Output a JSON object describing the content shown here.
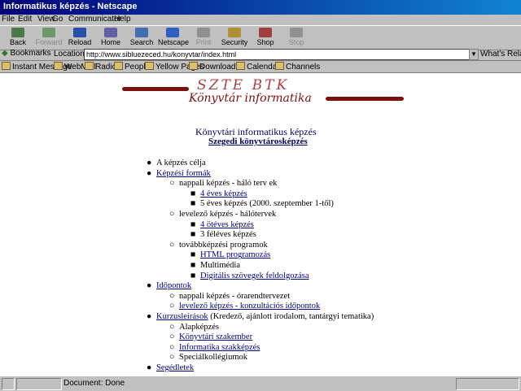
{
  "window": {
    "title": "Informatikus képzés - Netscape"
  },
  "menu": [
    "File",
    "Edit",
    "View",
    "Go",
    "Communicator",
    "Help"
  ],
  "toolbar": [
    {
      "label": "Back",
      "color": "#4a7a4a",
      "disabled": false
    },
    {
      "label": "Forward",
      "color": "#6a9a6a",
      "disabled": true
    },
    {
      "label": "Reload",
      "color": "#2850a8",
      "disabled": false
    },
    {
      "label": "Home",
      "color": "#6060a0",
      "disabled": false
    },
    {
      "label": "Search",
      "color": "#4070b0",
      "disabled": false
    },
    {
      "label": "Netscape",
      "color": "#3060c0",
      "disabled": false
    },
    {
      "label": "Print",
      "color": "#909090",
      "disabled": true
    },
    {
      "label": "Security",
      "color": "#b09030",
      "disabled": false
    },
    {
      "label": "Shop",
      "color": "#a04040",
      "disabled": false
    },
    {
      "label": "Stop",
      "color": "#909090",
      "disabled": true
    }
  ],
  "location": {
    "bookmarks_label": "Bookmarks",
    "label": "Location:",
    "url": "http://www.sibluezeced.hu/konyvtar/index.html",
    "related": "What's Related"
  },
  "personal_bar": [
    "Instant Message",
    "WebMail",
    "Radio",
    "People",
    "Yellow Pages",
    "Download",
    "Calendar",
    "Channels"
  ],
  "banner": {
    "line1": "SZTE BTK",
    "line2": "Könyvtár informatika"
  },
  "heading": "Könyvtári informatikus képzés",
  "subheading": "Szegedi könyvtárosképzés",
  "nav": [
    {
      "level": 0,
      "text": "A képzés célja",
      "link": false
    },
    {
      "level": 0,
      "text": "Képzési formák",
      "link": true
    },
    {
      "level": 1,
      "text": "nappali képzés - háló terv ek",
      "link": false
    },
    {
      "level": 2,
      "text": "4 éves képzés",
      "link": true
    },
    {
      "level": 2,
      "text": "5 éves képzés (2000. szeptember 1-től)",
      "link": false
    },
    {
      "level": 1,
      "text": "levelező képzés - hálótervek",
      "link": false
    },
    {
      "level": 2,
      "text": "4 ötéves képzés",
      "link": true
    },
    {
      "level": 2,
      "text": "3 féléves képzés",
      "link": false
    },
    {
      "level": 1,
      "text": "továbbképzési programok",
      "link": false
    },
    {
      "level": 2,
      "text": "HTML programozás",
      "link": true
    },
    {
      "level": 2,
      "text": "Multimédia",
      "link": false
    },
    {
      "level": 2,
      "text": "Digitális szövegek feldolgozása",
      "link": true
    },
    {
      "level": 0,
      "text": "Időpontok",
      "link": true
    },
    {
      "level": 1,
      "text": "nappali képzés - órarendtervezet",
      "link": false
    },
    {
      "level": 1,
      "text": "levelező képzés - konzultációs időpontok",
      "link": true
    },
    {
      "level": 0,
      "text": "Kurzusleírások",
      "link": true,
      "suffix": " (Kredező, ajánlott irodalom, tantárgyi tematika)"
    },
    {
      "level": 1,
      "text": "Alapképzés",
      "link": false
    },
    {
      "level": 1,
      "text": "Könyvtári szakember",
      "link": true
    },
    {
      "level": 1,
      "text": "Informatika szakképzés",
      "link": true
    },
    {
      "level": 1,
      "text": "Speciálkollégiumok",
      "link": false
    },
    {
      "level": 0,
      "text": "Segédletek",
      "link": true
    }
  ],
  "status": {
    "text": "Document: Done"
  }
}
